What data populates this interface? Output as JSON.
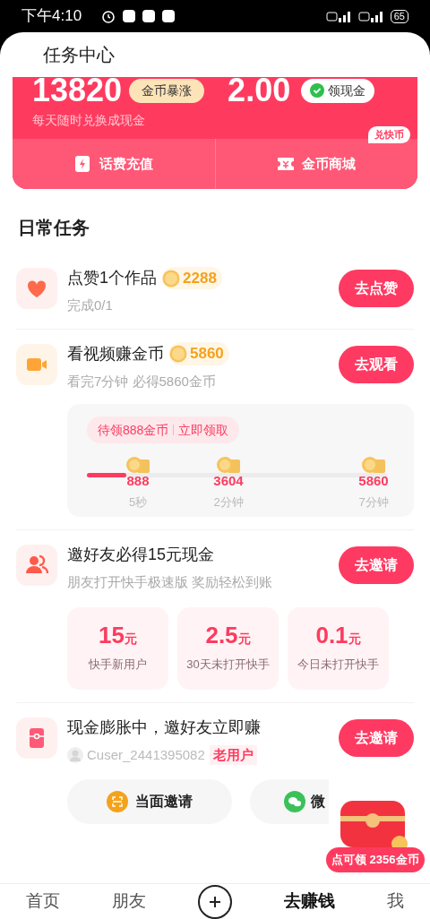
{
  "status_bar": {
    "time": "下午4:10",
    "battery": "65"
  },
  "header": {
    "title": "任务中心"
  },
  "balance_card": {
    "coins": "13820",
    "coins_badge": "金币暴涨",
    "cash": "2.00",
    "cash_button": "领现金",
    "hint": "每天随时兑换成现金",
    "actions": [
      {
        "label": "话费充值",
        "kind": "bolt"
      },
      {
        "label": "金币商城",
        "kind": "ticket",
        "badge": "兑快币"
      }
    ]
  },
  "section_title": "日常任务",
  "tasks": [
    {
      "kind": "like",
      "title": "点赞1个作品",
      "reward": "2288",
      "subtitle": "完成0/1",
      "button": "去点赞"
    },
    {
      "kind": "video",
      "title": "看视频赚金币",
      "reward": "5860",
      "subtitle": "看完7分钟 必得5860金币",
      "button": "去观看",
      "progress": {
        "tip": "待领888金币",
        "tip_action": "立即领取",
        "level": 0.13,
        "milestones": [
          {
            "value": "888",
            "time": "5秒"
          },
          {
            "value": "3604",
            "time": "2分钟"
          },
          {
            "value": "5860",
            "time": "7分钟"
          }
        ]
      }
    },
    {
      "kind": "friends",
      "title": "邀好友必得15元现金",
      "subtitle": "朋友打开快手极速版 奖励轻松到账",
      "button": "去邀请",
      "offers": [
        {
          "amount": "15",
          "unit": "元",
          "label": "快手新用户"
        },
        {
          "amount": "2.5",
          "unit": "元",
          "label": "30天未打开快手"
        },
        {
          "amount": "0.1",
          "unit": "元",
          "label": "今日未打开快手"
        }
      ]
    },
    {
      "kind": "envelope",
      "title": "现金膨胀中，邀好友立即赚",
      "user": "Cuser_2441395082",
      "user_tag": "老用户",
      "button": "去邀请",
      "share": [
        {
          "label": "当面邀请",
          "kind": "scan"
        },
        {
          "label": "微",
          "kind": "wechat"
        }
      ]
    }
  ],
  "floating_reward": {
    "label": "点可领 2356金币"
  },
  "nav": [
    {
      "label": "首页",
      "kind": "text",
      "selected": false
    },
    {
      "label": "朋友",
      "kind": "text",
      "selected": false
    },
    {
      "kind": "plus",
      "selected": false
    },
    {
      "label": "去赚钱",
      "kind": "text",
      "selected": true
    },
    {
      "label": "我",
      "kind": "text",
      "selected": false
    }
  ]
}
